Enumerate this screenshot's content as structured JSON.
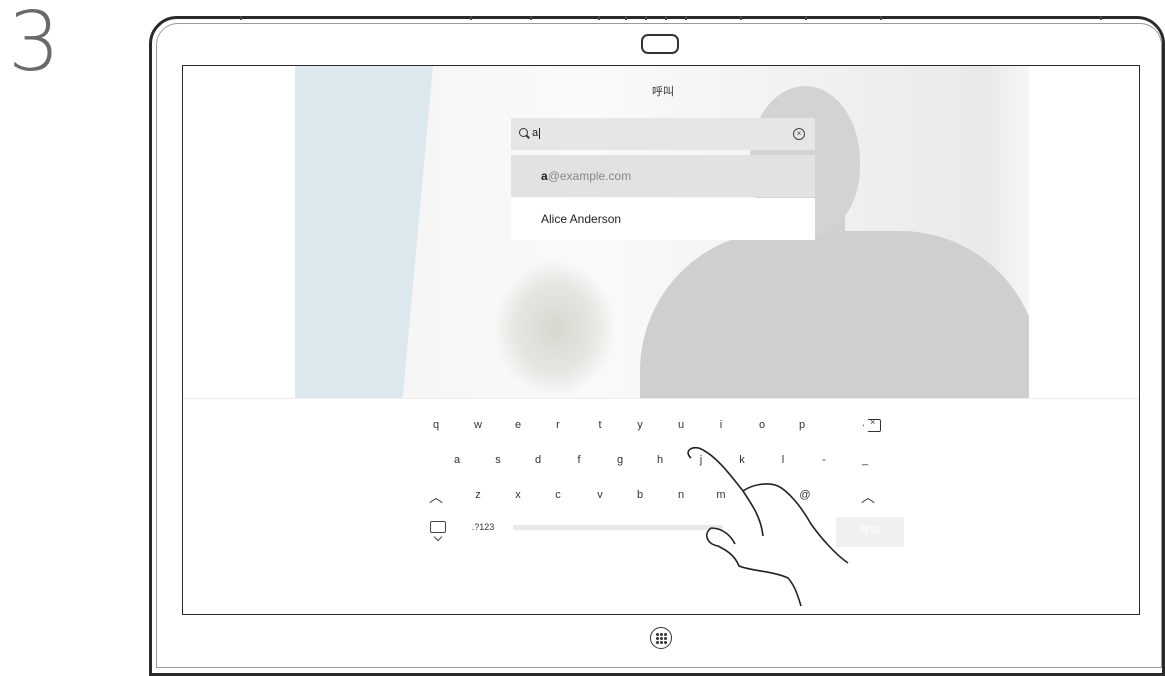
{
  "step_number": "3",
  "screen": {
    "title": "呼叫",
    "search": {
      "value": "a"
    },
    "suggestions": [
      {
        "match": "a",
        "rest": "@example.com",
        "highlighted": true
      },
      {
        "text": "Alice Anderson",
        "highlighted": false
      }
    ]
  },
  "keyboard": {
    "row1": [
      "q",
      "w",
      "e",
      "r",
      "t",
      "y",
      "u",
      "i",
      "o",
      "p"
    ],
    "row2": [
      "a",
      "s",
      "d",
      "f",
      "g",
      "h",
      "j",
      "k",
      "l",
      "-",
      "_"
    ],
    "row3": [
      "z",
      "x",
      "c",
      "v",
      "b",
      "n",
      "m",
      "@"
    ],
    "symbols_label": ".?123",
    "enter_label": "呼叫",
    "icons": {
      "backspace": "backspace-icon",
      "shift": "shift-icon",
      "hide": "hide-keyboard-icon"
    }
  },
  "colors": {
    "background": "#ffffff",
    "frame": "#2a2a2a",
    "highlight_row": "#e2e2e2",
    "search_bg": "#e6e6e6"
  }
}
